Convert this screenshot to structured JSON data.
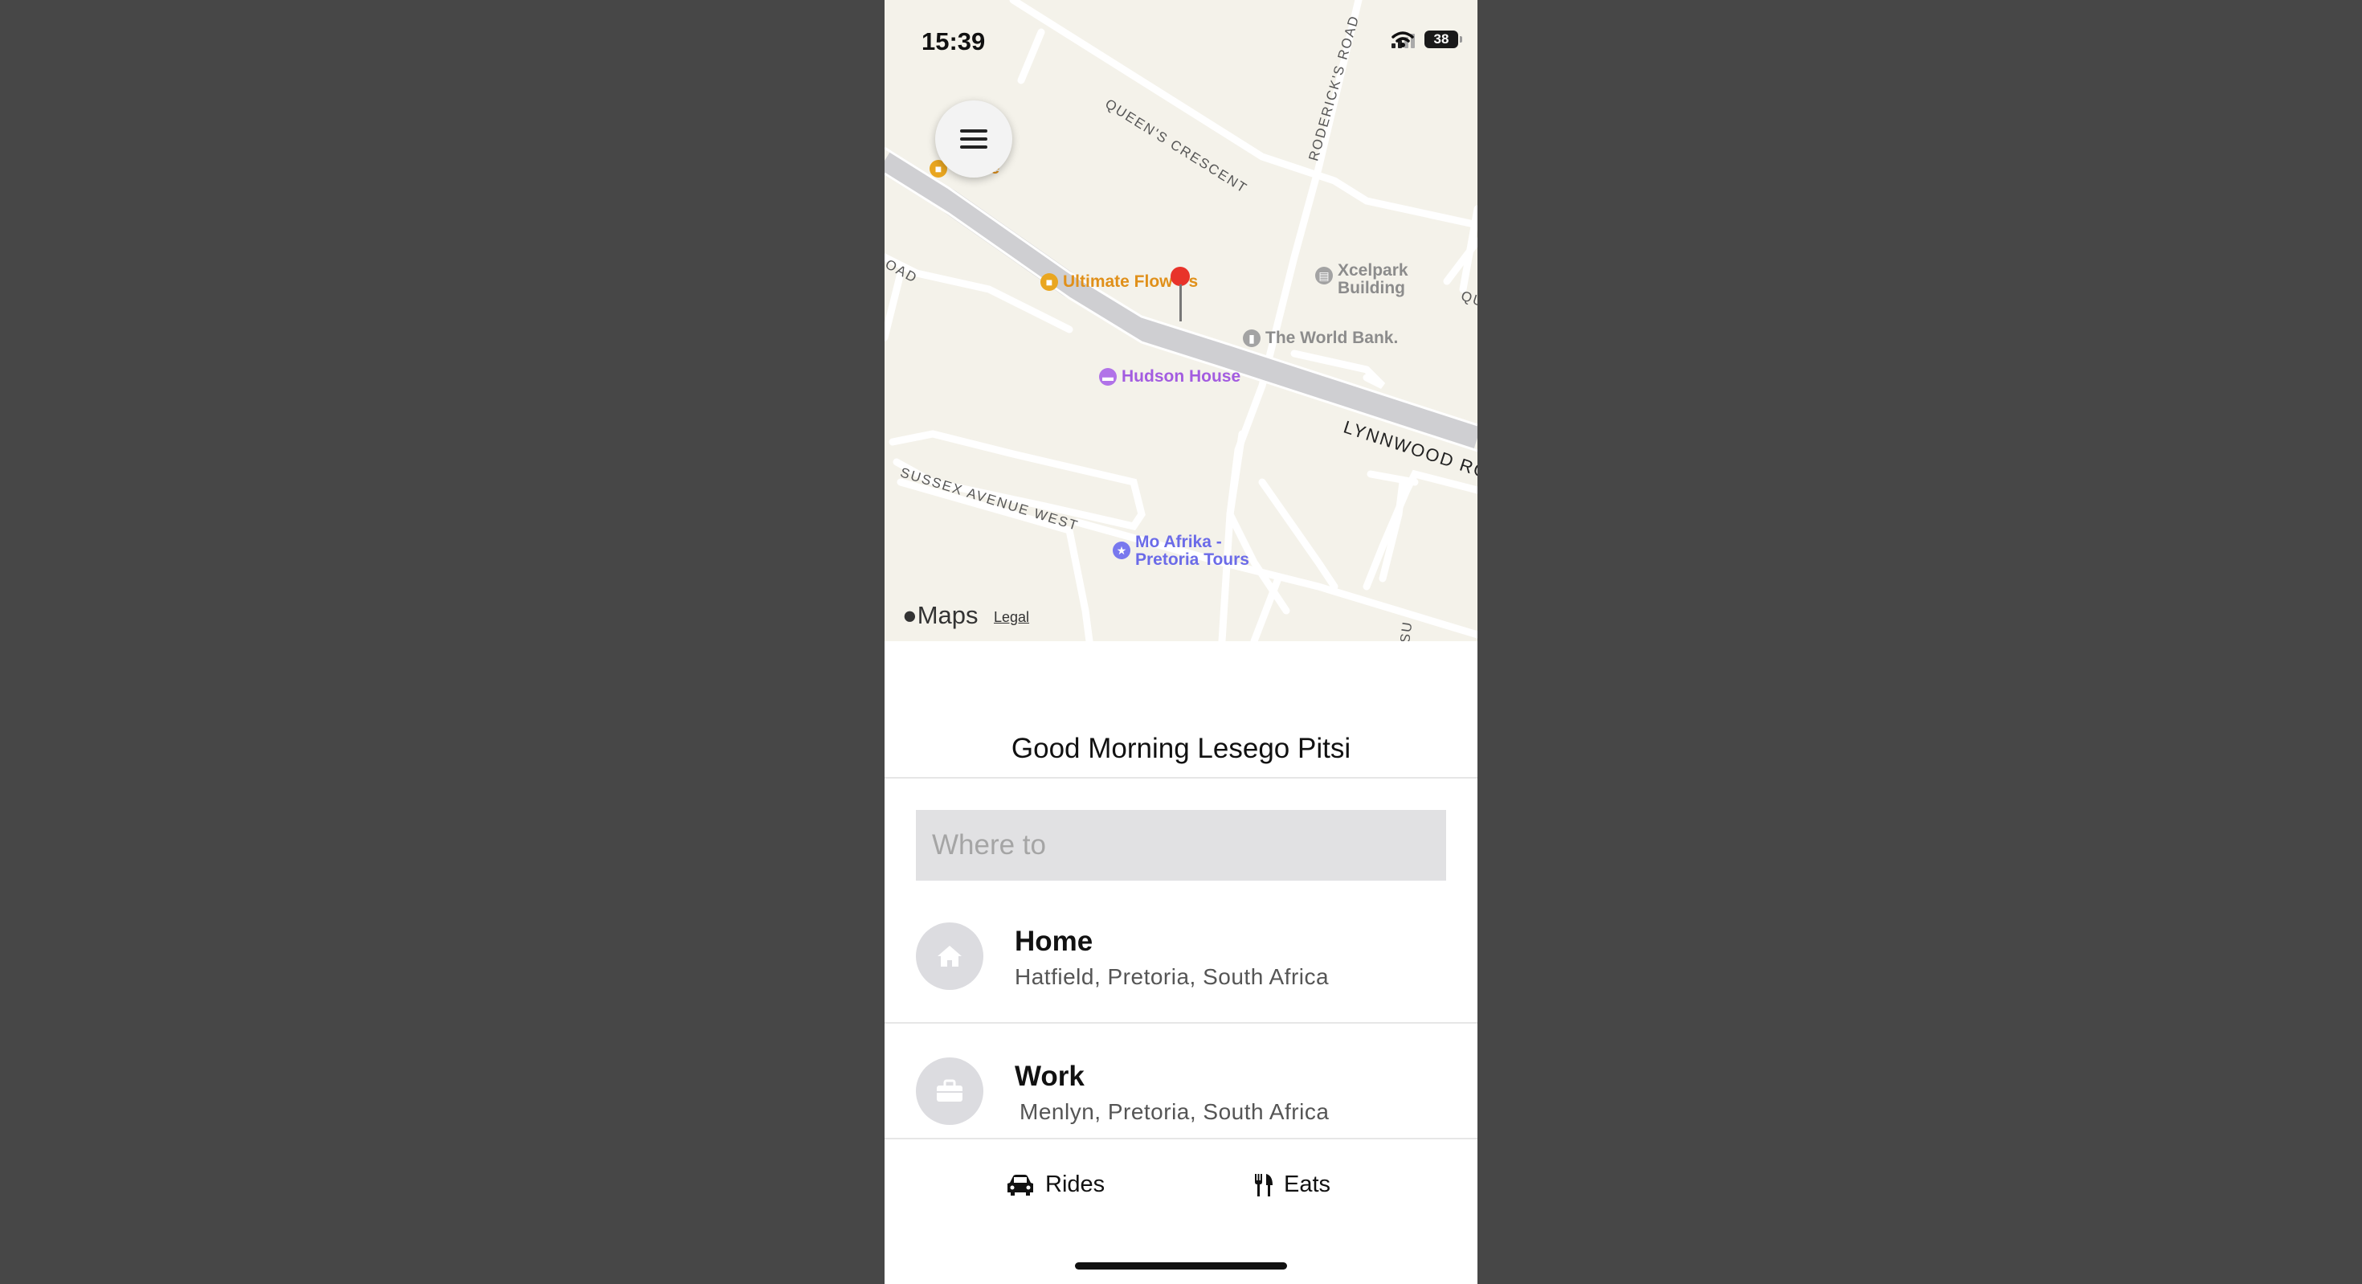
{
  "status_bar": {
    "time": "15:39",
    "battery": "38",
    "icons": [
      "signal-icon",
      "wifi-icon",
      "battery-icon"
    ]
  },
  "map": {
    "menu_icon": "hamburger-menu-icon",
    "roads": [
      "QUEEN'S CRESCENT",
      "RODERICK'S ROAD",
      "LYNNWOOD RO",
      "SUSSEX AVENUE WEST",
      "OAD",
      "QU",
      "SU"
    ],
    "pois": [
      {
        "name": "Ultimate Flow",
        "name_tail": "s",
        "color": "#e0901a",
        "icon": "shopping-bag-icon"
      },
      {
        "name": "Xcelpark",
        "name_line2": "Building",
        "color": "#8c8c8c",
        "icon": "parking-icon"
      },
      {
        "name": "The World Bank.",
        "color": "#8c8c8c",
        "icon": "building-icon"
      },
      {
        "name": "Hudson House",
        "color": "#a35ce0",
        "icon": "bed-icon"
      },
      {
        "name": "Mo Afrika -",
        "name_line2": "Pretoria Tours",
        "color": "#6b6be8",
        "icon": "star-icon"
      },
      {
        "name": "ice",
        "color": "#e0901a",
        "icon": "shopping-bag-icon"
      }
    ],
    "attribution": "Maps",
    "legal": "Legal"
  },
  "greeting": "Good Morning Lesego Pitsi",
  "search": {
    "placeholder": "Where to"
  },
  "saved_places": [
    {
      "name": "Home",
      "address": "Hatfield, Pretoria, South Africa",
      "icon": "house-icon"
    },
    {
      "name": "Work",
      "address": "Menlyn, Pretoria, South Africa",
      "icon": "briefcase-icon"
    }
  ],
  "tabs": [
    {
      "label": "Rides",
      "icon": "car-icon"
    },
    {
      "label": "Eats",
      "icon": "fork-knife-icon"
    }
  ],
  "colors": {
    "background": "#474747",
    "map": "#f4f2ea",
    "search_bg": "#e1e1e3",
    "pin": "#e8332a"
  }
}
